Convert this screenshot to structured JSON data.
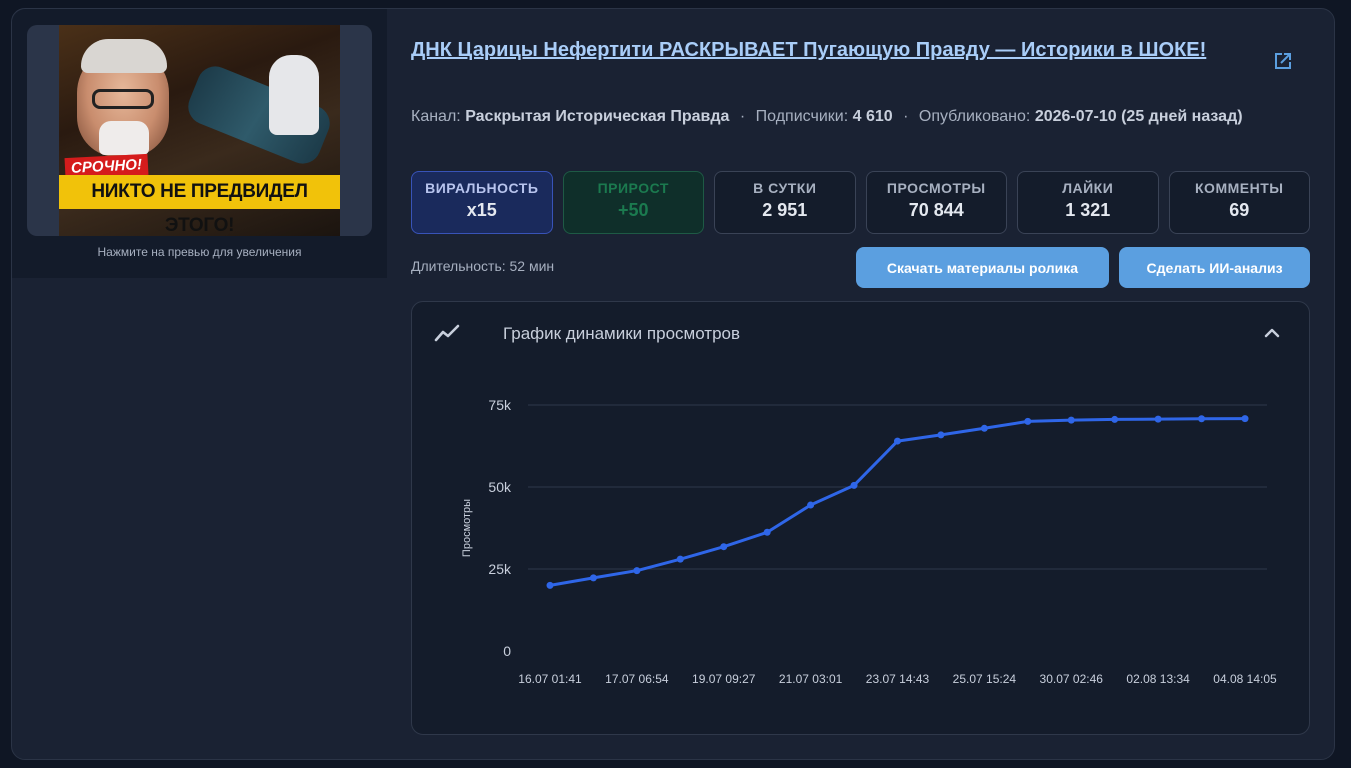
{
  "thumbnail": {
    "tag_text": "СРОЧНО!",
    "banner_text": "НИКТО НЕ ПРЕДВИДЕЛ ЭТОГО!",
    "hint": "Нажмите на превью для увеличения"
  },
  "video": {
    "title": "ДНК Царицы Нефертити РАСКРЫВАЕТ Пугающую Правду — Историки в ШОКЕ!",
    "channel_label": "Канал:",
    "channel_name": "Раскрытая Историческая Правда",
    "subscribers_label": "Подписчики:",
    "subscribers_value": "4 610",
    "published_label": "Опубликовано:",
    "published_value": "2026-07-10 (25 дней назад)",
    "separator": "·",
    "duration": "Длительность: 52 мин"
  },
  "stats": [
    {
      "label": "ВИРАЛЬНОСТЬ",
      "value": "x15"
    },
    {
      "label": "ПРИРОСТ",
      "value": "+50"
    },
    {
      "label": "В СУТКИ",
      "value": "2 951"
    },
    {
      "label": "ПРОСМОТРЫ",
      "value": "70 844"
    },
    {
      "label": "ЛАЙКИ",
      "value": "1 321"
    },
    {
      "label": "КОММЕНТЫ",
      "value": "69"
    }
  ],
  "actions": {
    "download_label": "Скачать материалы ролика",
    "ai_label": "Сделать ИИ-анализ"
  },
  "chart_panel": {
    "title": "График динамики просмотров"
  },
  "colors": {
    "line": "#2f66e8",
    "accent": "#5b9fe0",
    "title_link": "#a9cdf8"
  },
  "chart_data": {
    "type": "line",
    "ylabel": "Просмотры",
    "ylim": [
      0,
      75000
    ],
    "yticks": [
      0,
      25000,
      50000,
      75000
    ],
    "ytick_labels": [
      "0",
      "25k",
      "50k",
      "75k"
    ],
    "x_tick_labels": [
      "16.07 01:41",
      "17.07 06:54",
      "19.07 09:27",
      "21.07 03:01",
      "23.07 14:43",
      "25.07 15:24",
      "30.07 02:46",
      "02.08 13:34",
      "04.08 14:05"
    ],
    "grid": true,
    "series": [
      {
        "values": [
          20000,
          22300,
          24500,
          28000,
          31800,
          36200,
          44500,
          50500,
          64000,
          65900,
          67900,
          70000,
          70400,
          70600,
          70700,
          70800,
          70844
        ]
      }
    ]
  }
}
